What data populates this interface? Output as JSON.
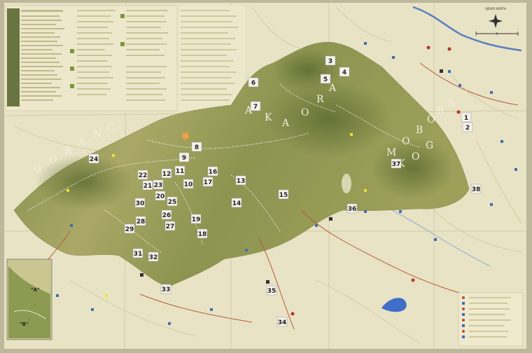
{
  "map": {
    "compass": {
      "label": "SJEVER NORTH"
    },
    "mountain_labels": [
      "G",
      "O",
      "R",
      "A",
      "N",
      "C",
      "A",
      "K",
      "A",
      "O",
      "R",
      "A",
      "M",
      "O",
      "B",
      "O",
      "R",
      "S",
      "K",
      "O",
      "G"
    ],
    "inset_labels": [
      "\"A\"",
      "\"B\""
    ],
    "markers": [
      "1",
      "2",
      "3",
      "4",
      "5",
      "6",
      "7",
      "8",
      "9",
      "10",
      "11",
      "12",
      "13",
      "14",
      "15",
      "16",
      "17",
      "18",
      "19",
      "20",
      "21",
      "22",
      "23",
      "24",
      "25",
      "26",
      "27",
      "28",
      "29",
      "30",
      "31",
      "32",
      "33",
      "34",
      "35",
      "36",
      "37",
      "38"
    ],
    "colors": {
      "paper": "#e9e3c5",
      "mountain_dark": "#6e7a3a",
      "mountain_mid": "#9ba25a",
      "mountain_light": "#c8c684",
      "river": "#5a7fc0",
      "road": "#b55b3d",
      "trail": "#ffffff"
    }
  }
}
